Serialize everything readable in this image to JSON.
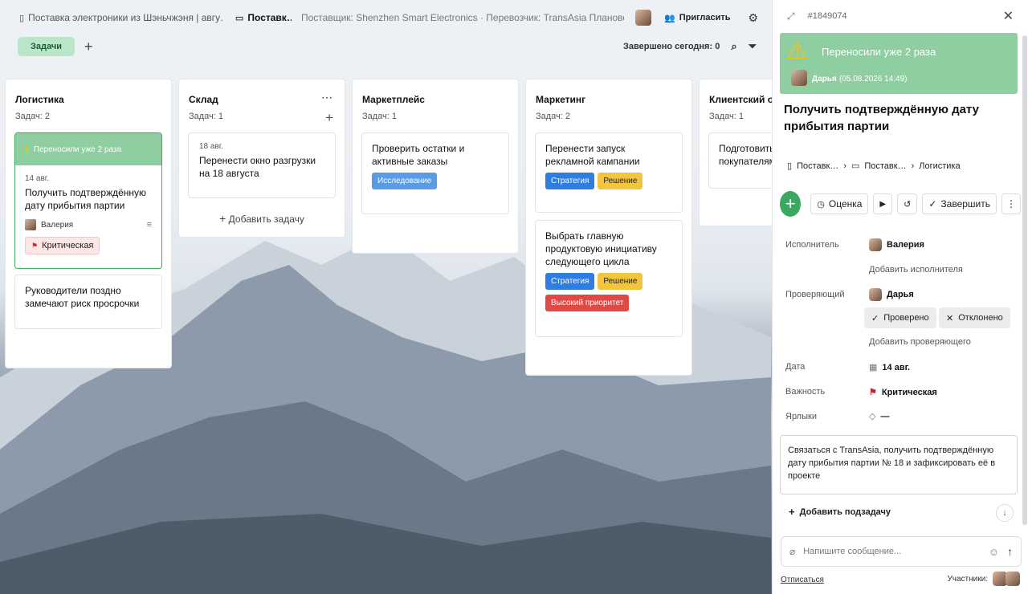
{
  "topbar": {
    "crumb1": "Поставка электроники из Шэньчжэня | авгу…",
    "crumb2": "Поставк…",
    "crumb3": "Поставщик: Shenzhen Smart Electronics · Перевозчик: TransAsia Планово…",
    "invite_label": "Пригласить"
  },
  "toolbar": {
    "tab_tasks": "Задачи",
    "done_today": "Завершено сегодня: 0"
  },
  "columns": [
    {
      "title": "Логистика",
      "count": "Задач: 2"
    },
    {
      "title": "Склад",
      "count": "Задач: 1",
      "add_task": "Добавить задачу"
    },
    {
      "title": "Маркетплейс",
      "count": "Задач: 1"
    },
    {
      "title": "Маркетинг",
      "count": "Задач: 2"
    },
    {
      "title": "Клиентский от",
      "count": "Задач: 1"
    }
  ],
  "cards": {
    "logistics1": {
      "banner": "Переносили уже 2 раза",
      "date": "14 авг.",
      "text": "Получить подтверждённую дату прибытия партии",
      "assignee": "Валерия",
      "priority": "Критическая"
    },
    "logistics2": {
      "text": "Руководители поздно замечают риск просрочки"
    },
    "warehouse1": {
      "date": "18 авг.",
      "text": "Перенести окно разгрузки на 18 августа"
    },
    "market1": {
      "text": "Проверить остатки и активные заказы",
      "tags": [
        "Исследование"
      ]
    },
    "marketing1": {
      "text": "Перенести запуск рекламной кампании",
      "tags": [
        "Стратегия",
        "Решение"
      ]
    },
    "marketing2": {
      "text": "Выбрать главную продуктовую инициативу следующего цикла",
      "tags": [
        "Стратегия",
        "Решение",
        "Высокий приоритет"
      ]
    },
    "client1": {
      "text": "Подготовить покупателям"
    }
  },
  "panel": {
    "task_id": "#1849074",
    "banner_text": "Переносили уже 2 раза",
    "banner_user": "Дарья",
    "banner_time": "(05.08.2026 14:49)",
    "title": "Получить подтверждённую дату прибытия партии",
    "crumb": [
      "Поставк…",
      "Поставк…",
      "Логистика"
    ],
    "actions": {
      "estimate": "Оценка",
      "complete": "Завершить"
    },
    "fields": {
      "assignee_label": "Исполнитель",
      "assignee": "Валерия",
      "add_assignee": "Добавить исполнителя",
      "reviewer_label": "Проверяющий",
      "reviewer": "Дарья",
      "approved": "Проверено",
      "rejected": "Отклонено",
      "add_reviewer": "Добавить проверяющего",
      "date_label": "Дата",
      "date": "14 авг.",
      "priority_label": "Важность",
      "priority": "Критическая",
      "labels_label": "Ярлыки",
      "labels": "—"
    },
    "description": "Связаться с TransAsia, получить подтверждённую дату прибытия партии № 18 и зафиксировать её в проекте",
    "add_subtask": "Добавить подзадачу",
    "message_placeholder": "Напишите сообщение...",
    "unsubscribe": "Отписаться",
    "participants": "Участники:"
  },
  "colors": {
    "accent_green": "#3aa95f",
    "banner_green": "#8fcea0",
    "tag_blue": "#2f7de1",
    "tag_yellow": "#f2c53f",
    "tag_red": "#df4a47"
  }
}
